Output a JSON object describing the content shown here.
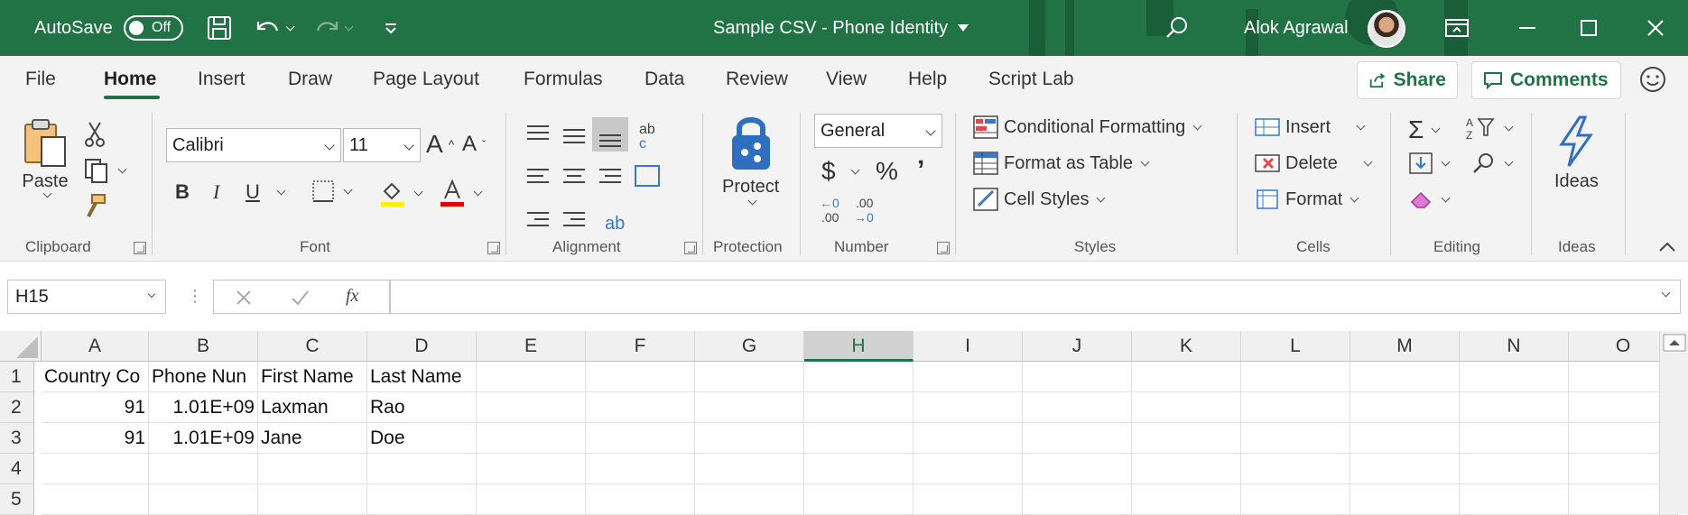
{
  "titlebar": {
    "autosave_label": "AutoSave",
    "autosave_state": "Off",
    "document_title": "Sample CSV - Phone Identity",
    "user_name": "Alok Agrawal"
  },
  "tabs": [
    "File",
    "Home",
    "Insert",
    "Draw",
    "Page Layout",
    "Formulas",
    "Data",
    "Review",
    "View",
    "Help",
    "Script Lab"
  ],
  "active_tab": "Home",
  "actions": {
    "share": "Share",
    "comments": "Comments"
  },
  "ribbon": {
    "clipboard": {
      "paste": "Paste",
      "group": "Clipboard"
    },
    "font": {
      "name": "Calibri",
      "size": "11",
      "bold": "B",
      "italic": "I",
      "underline": "U",
      "group": "Font"
    },
    "alignment": {
      "group": "Alignment"
    },
    "protection": {
      "protect": "Protect",
      "group": "Protection"
    },
    "number": {
      "format": "General",
      "currency": "$",
      "percent": "%",
      "comma": "ʼ",
      "group": "Number"
    },
    "styles": {
      "conditional": "Conditional Formatting",
      "format_table": "Format as Table",
      "cell_styles": "Cell Styles",
      "group": "Styles"
    },
    "cells": {
      "insert": "Insert",
      "delete": "Delete",
      "format": "Format",
      "group": "Cells"
    },
    "editing": {
      "group": "Editing"
    },
    "ideas": {
      "label": "Ideas",
      "group": "Ideas"
    }
  },
  "formula_bar": {
    "name_box": "H15",
    "fx": "fx",
    "value": ""
  },
  "sheet": {
    "columns": [
      "A",
      "B",
      "C",
      "D",
      "E",
      "F",
      "G",
      "H",
      "I",
      "J",
      "K",
      "L",
      "M",
      "N",
      "O"
    ],
    "selected_column": "H",
    "rows": [
      "1",
      "2",
      "3",
      "4",
      "5"
    ],
    "cells": [
      [
        "Country Co",
        "Phone Nun",
        "First Name",
        "Last Name"
      ],
      [
        "91",
        "1.01E+09",
        "Laxman",
        "Rao"
      ],
      [
        "91",
        "1.01E+09",
        "Jane",
        "Doe"
      ]
    ]
  },
  "colors": {
    "excel_green": "#217346",
    "ribbon_bg": "#f3f3f3"
  }
}
